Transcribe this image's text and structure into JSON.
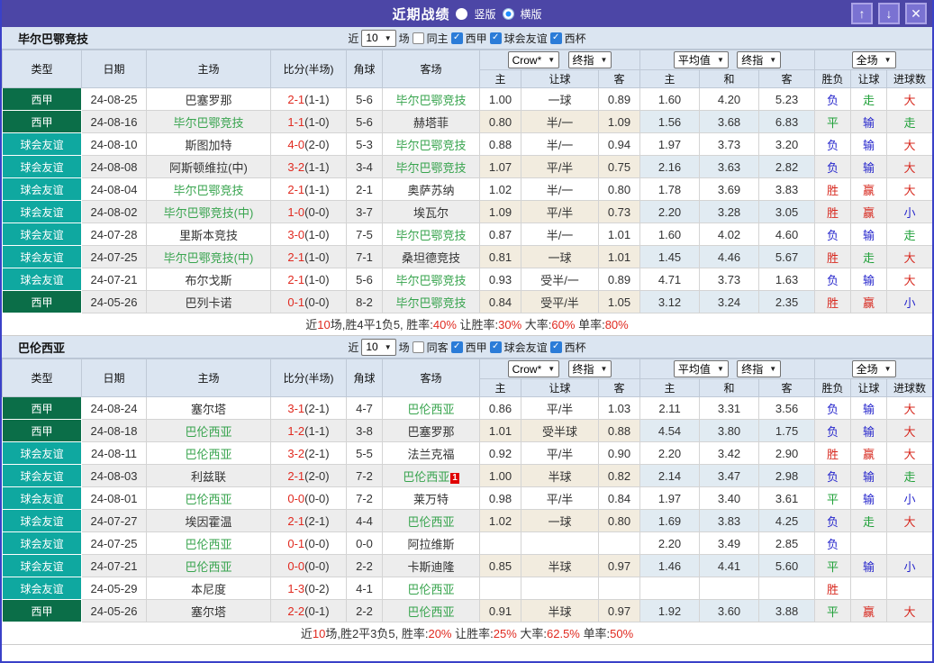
{
  "header": {
    "title": "近期战绩",
    "vertical_label": "竖版",
    "horizontal_label": "横版",
    "vertical_checked": false,
    "horizontal_checked": true
  },
  "icons": {
    "up": "↑",
    "down": "↓",
    "close": "✕",
    "dropdown": "▼"
  },
  "colors": {
    "titlebar": "#4c46a6",
    "team_green": "#38a44e",
    "score_red": "#e02a20",
    "checkbox_blue": "#2b7cd8"
  },
  "type_colors": {
    "西甲": "#0b6e48",
    "球会友谊": "#0fa8a0"
  },
  "result_colors": {
    "胜": "#d7281e",
    "平": "#1fa038",
    "负": "#2626cc",
    "赢": "#d7281e",
    "走": "#1fa038",
    "输": "#2626cc",
    "大": "#d7281e",
    "小": "#2626cc"
  },
  "table_header": {
    "base_cols": [
      "类型",
      "日期",
      "主场",
      "比分(半场)",
      "角球",
      "客场"
    ],
    "odds_source": "Crow*",
    "odds_index": "终指",
    "avg_source": "平均值",
    "avg_index": "终指",
    "scope": "全场",
    "odds_cols": [
      "主",
      "让球",
      "客"
    ],
    "avg_cols": [
      "主",
      "和",
      "客"
    ],
    "result_cols": [
      "胜负",
      "让球",
      "进球数"
    ]
  },
  "sections": [
    {
      "team": "毕尔巴鄂竞技",
      "filters": {
        "near_label": "近",
        "count": "10",
        "games_label": "场",
        "venue_label": "同主",
        "venue_checked": false,
        "leagues": [
          {
            "label": "西甲",
            "checked": true
          },
          {
            "label": "球会友谊",
            "checked": true
          },
          {
            "label": "西杯",
            "checked": true
          }
        ]
      },
      "rows": [
        {
          "type": "西甲",
          "date": "24-08-25",
          "home": "巴塞罗那",
          "home_is_team": false,
          "score": "2-1",
          "half": "(1-1)",
          "corners": "5-6",
          "away": "毕尔巴鄂竞技",
          "away_is_team": true,
          "away_red_cards": "",
          "crow_home": "1.00",
          "crow_handicap": "一球",
          "crow_away": "0.89",
          "avg_home": "1.60",
          "avg_draw": "4.20",
          "avg_away": "5.23",
          "result_wdl": "负",
          "result_handicap": "走",
          "result_goals": "大"
        },
        {
          "type": "西甲",
          "date": "24-08-16",
          "home": "毕尔巴鄂竞技",
          "home_is_team": true,
          "score": "1-1",
          "half": "(1-0)",
          "corners": "5-6",
          "away": "赫塔菲",
          "away_is_team": false,
          "away_red_cards": "",
          "crow_home": "0.80",
          "crow_handicap": "半/一",
          "crow_away": "1.09",
          "avg_home": "1.56",
          "avg_draw": "3.68",
          "avg_away": "6.83",
          "result_wdl": "平",
          "result_handicap": "输",
          "result_goals": "走"
        },
        {
          "type": "球会友谊",
          "date": "24-08-10",
          "home": "斯图加特",
          "home_is_team": false,
          "score": "4-0",
          "half": "(2-0)",
          "corners": "5-3",
          "away": "毕尔巴鄂竞技",
          "away_is_team": true,
          "away_red_cards": "",
          "crow_home": "0.88",
          "crow_handicap": "半/一",
          "crow_away": "0.94",
          "avg_home": "1.97",
          "avg_draw": "3.73",
          "avg_away": "3.20",
          "result_wdl": "负",
          "result_handicap": "输",
          "result_goals": "大"
        },
        {
          "type": "球会友谊",
          "date": "24-08-08",
          "home": "阿斯顿维拉(中)",
          "home_is_team": false,
          "score": "3-2",
          "half": "(1-1)",
          "corners": "3-4",
          "away": "毕尔巴鄂竞技",
          "away_is_team": true,
          "away_red_cards": "",
          "crow_home": "1.07",
          "crow_handicap": "平/半",
          "crow_away": "0.75",
          "avg_home": "2.16",
          "avg_draw": "3.63",
          "avg_away": "2.82",
          "result_wdl": "负",
          "result_handicap": "输",
          "result_goals": "大"
        },
        {
          "type": "球会友谊",
          "date": "24-08-04",
          "home": "毕尔巴鄂竞技",
          "home_is_team": true,
          "score": "2-1",
          "half": "(1-1)",
          "corners": "2-1",
          "away": "奥萨苏纳",
          "away_is_team": false,
          "away_red_cards": "",
          "crow_home": "1.02",
          "crow_handicap": "半/一",
          "crow_away": "0.80",
          "avg_home": "1.78",
          "avg_draw": "3.69",
          "avg_away": "3.83",
          "result_wdl": "胜",
          "result_handicap": "赢",
          "result_goals": "大"
        },
        {
          "type": "球会友谊",
          "date": "24-08-02",
          "home": "毕尔巴鄂竞技(中)",
          "home_is_team": true,
          "score": "1-0",
          "half": "(0-0)",
          "corners": "3-7",
          "away": "埃瓦尔",
          "away_is_team": false,
          "away_red_cards": "",
          "crow_home": "1.09",
          "crow_handicap": "平/半",
          "crow_away": "0.73",
          "avg_home": "2.20",
          "avg_draw": "3.28",
          "avg_away": "3.05",
          "result_wdl": "胜",
          "result_handicap": "赢",
          "result_goals": "小"
        },
        {
          "type": "球会友谊",
          "date": "24-07-28",
          "home": "里斯本竞技",
          "home_is_team": false,
          "score": "3-0",
          "half": "(1-0)",
          "corners": "7-5",
          "away": "毕尔巴鄂竞技",
          "away_is_team": true,
          "away_red_cards": "",
          "crow_home": "0.87",
          "crow_handicap": "半/一",
          "crow_away": "1.01",
          "avg_home": "1.60",
          "avg_draw": "4.02",
          "avg_away": "4.60",
          "result_wdl": "负",
          "result_handicap": "输",
          "result_goals": "走"
        },
        {
          "type": "球会友谊",
          "date": "24-07-25",
          "home": "毕尔巴鄂竞技(中)",
          "home_is_team": true,
          "score": "2-1",
          "half": "(1-0)",
          "corners": "7-1",
          "away": "桑坦德竞技",
          "away_is_team": false,
          "away_red_cards": "",
          "crow_home": "0.81",
          "crow_handicap": "一球",
          "crow_away": "1.01",
          "avg_home": "1.45",
          "avg_draw": "4.46",
          "avg_away": "5.67",
          "result_wdl": "胜",
          "result_handicap": "走",
          "result_goals": "大"
        },
        {
          "type": "球会友谊",
          "date": "24-07-21",
          "home": "布尔戈斯",
          "home_is_team": false,
          "score": "2-1",
          "half": "(1-0)",
          "corners": "5-6",
          "away": "毕尔巴鄂竞技",
          "away_is_team": true,
          "away_red_cards": "",
          "crow_home": "0.93",
          "crow_handicap": "受半/一",
          "crow_away": "0.89",
          "avg_home": "4.71",
          "avg_draw": "3.73",
          "avg_away": "1.63",
          "result_wdl": "负",
          "result_handicap": "输",
          "result_goals": "大"
        },
        {
          "type": "西甲",
          "date": "24-05-26",
          "home": "巴列卡诺",
          "home_is_team": false,
          "score": "0-1",
          "half": "(0-0)",
          "corners": "8-2",
          "away": "毕尔巴鄂竞技",
          "away_is_team": true,
          "away_red_cards": "",
          "crow_home": "0.84",
          "crow_handicap": "受平/半",
          "crow_away": "1.05",
          "avg_home": "3.12",
          "avg_draw": "3.24",
          "avg_away": "2.35",
          "result_wdl": "胜",
          "result_handicap": "赢",
          "result_goals": "小"
        }
      ],
      "summary": [
        {
          "text": "近",
          "red": false
        },
        {
          "text": "10",
          "red": true
        },
        {
          "text": "场,胜4平1负5, 胜率:",
          "red": false
        },
        {
          "text": "40%",
          "red": true
        },
        {
          "text": " 让胜率:",
          "red": false
        },
        {
          "text": "30%",
          "red": true
        },
        {
          "text": " 大率:",
          "red": false
        },
        {
          "text": "60%",
          "red": true
        },
        {
          "text": " 单率:",
          "red": false
        },
        {
          "text": "80%",
          "red": true
        }
      ]
    },
    {
      "team": "巴伦西亚",
      "filters": {
        "near_label": "近",
        "count": "10",
        "games_label": "场",
        "venue_label": "同客",
        "venue_checked": false,
        "leagues": [
          {
            "label": "西甲",
            "checked": true
          },
          {
            "label": "球会友谊",
            "checked": true
          },
          {
            "label": "西杯",
            "checked": true
          }
        ]
      },
      "rows": [
        {
          "type": "西甲",
          "date": "24-08-24",
          "home": "塞尔塔",
          "home_is_team": false,
          "score": "3-1",
          "half": "(2-1)",
          "corners": "4-7",
          "away": "巴伦西亚",
          "away_is_team": true,
          "away_red_cards": "",
          "crow_home": "0.86",
          "crow_handicap": "平/半",
          "crow_away": "1.03",
          "avg_home": "2.11",
          "avg_draw": "3.31",
          "avg_away": "3.56",
          "result_wdl": "负",
          "result_handicap": "输",
          "result_goals": "大"
        },
        {
          "type": "西甲",
          "date": "24-08-18",
          "home": "巴伦西亚",
          "home_is_team": true,
          "score": "1-2",
          "half": "(1-1)",
          "corners": "3-8",
          "away": "巴塞罗那",
          "away_is_team": false,
          "away_red_cards": "",
          "crow_home": "1.01",
          "crow_handicap": "受半球",
          "crow_away": "0.88",
          "avg_home": "4.54",
          "avg_draw": "3.80",
          "avg_away": "1.75",
          "result_wdl": "负",
          "result_handicap": "输",
          "result_goals": "大"
        },
        {
          "type": "球会友谊",
          "date": "24-08-11",
          "home": "巴伦西亚",
          "home_is_team": true,
          "score": "3-2",
          "half": "(2-1)",
          "corners": "5-5",
          "away": "法兰克福",
          "away_is_team": false,
          "away_red_cards": "",
          "crow_home": "0.92",
          "crow_handicap": "平/半",
          "crow_away": "0.90",
          "avg_home": "2.20",
          "avg_draw": "3.42",
          "avg_away": "2.90",
          "result_wdl": "胜",
          "result_handicap": "赢",
          "result_goals": "大"
        },
        {
          "type": "球会友谊",
          "date": "24-08-03",
          "home": "利兹联",
          "home_is_team": false,
          "score": "2-1",
          "half": "(2-0)",
          "corners": "7-2",
          "away": "巴伦西亚",
          "away_is_team": true,
          "away_red_cards": "1",
          "crow_home": "1.00",
          "crow_handicap": "半球",
          "crow_away": "0.82",
          "avg_home": "2.14",
          "avg_draw": "3.47",
          "avg_away": "2.98",
          "result_wdl": "负",
          "result_handicap": "输",
          "result_goals": "走"
        },
        {
          "type": "球会友谊",
          "date": "24-08-01",
          "home": "巴伦西亚",
          "home_is_team": true,
          "score": "0-0",
          "half": "(0-0)",
          "corners": "7-2",
          "away": "莱万特",
          "away_is_team": false,
          "away_red_cards": "",
          "crow_home": "0.98",
          "crow_handicap": "平/半",
          "crow_away": "0.84",
          "avg_home": "1.97",
          "avg_draw": "3.40",
          "avg_away": "3.61",
          "result_wdl": "平",
          "result_handicap": "输",
          "result_goals": "小"
        },
        {
          "type": "球会友谊",
          "date": "24-07-27",
          "home": "埃因霍温",
          "home_is_team": false,
          "score": "2-1",
          "half": "(2-1)",
          "corners": "4-4",
          "away": "巴伦西亚",
          "away_is_team": true,
          "away_red_cards": "",
          "crow_home": "1.02",
          "crow_handicap": "一球",
          "crow_away": "0.80",
          "avg_home": "1.69",
          "avg_draw": "3.83",
          "avg_away": "4.25",
          "result_wdl": "负",
          "result_handicap": "走",
          "result_goals": "大"
        },
        {
          "type": "球会友谊",
          "date": "24-07-25",
          "home": "巴伦西亚",
          "home_is_team": true,
          "score": "0-1",
          "half": "(0-0)",
          "corners": "0-0",
          "away": "阿拉维斯",
          "away_is_team": false,
          "away_red_cards": "",
          "crow_home": "",
          "crow_handicap": "",
          "crow_away": "",
          "avg_home": "2.20",
          "avg_draw": "3.49",
          "avg_away": "2.85",
          "result_wdl": "负",
          "result_handicap": "",
          "result_goals": ""
        },
        {
          "type": "球会友谊",
          "date": "24-07-21",
          "home": "巴伦西亚",
          "home_is_team": true,
          "score": "0-0",
          "half": "(0-0)",
          "corners": "2-2",
          "away": "卡斯迪隆",
          "away_is_team": false,
          "away_red_cards": "",
          "crow_home": "0.85",
          "crow_handicap": "半球",
          "crow_away": "0.97",
          "avg_home": "1.46",
          "avg_draw": "4.41",
          "avg_away": "5.60",
          "result_wdl": "平",
          "result_handicap": "输",
          "result_goals": "小"
        },
        {
          "type": "球会友谊",
          "date": "24-05-29",
          "home": "本尼度",
          "home_is_team": false,
          "score": "1-3",
          "half": "(0-2)",
          "corners": "4-1",
          "away": "巴伦西亚",
          "away_is_team": true,
          "away_red_cards": "",
          "crow_home": "",
          "crow_handicap": "",
          "crow_away": "",
          "avg_home": "",
          "avg_draw": "",
          "avg_away": "",
          "result_wdl": "胜",
          "result_handicap": "",
          "result_goals": ""
        },
        {
          "type": "西甲",
          "date": "24-05-26",
          "home": "塞尔塔",
          "home_is_team": false,
          "score": "2-2",
          "half": "(0-1)",
          "corners": "2-2",
          "away": "巴伦西亚",
          "away_is_team": true,
          "away_red_cards": "",
          "crow_home": "0.91",
          "crow_handicap": "半球",
          "crow_away": "0.97",
          "avg_home": "1.92",
          "avg_draw": "3.60",
          "avg_away": "3.88",
          "result_wdl": "平",
          "result_handicap": "赢",
          "result_goals": "大"
        }
      ],
      "summary": [
        {
          "text": "近",
          "red": false
        },
        {
          "text": "10",
          "red": true
        },
        {
          "text": "场,胜2平3负5, 胜率:",
          "red": false
        },
        {
          "text": "20%",
          "red": true
        },
        {
          "text": " 让胜率:",
          "red": false
        },
        {
          "text": "25%",
          "red": true
        },
        {
          "text": " 大率:",
          "red": false
        },
        {
          "text": "62.5%",
          "red": true
        },
        {
          "text": " 单率:",
          "red": false
        },
        {
          "text": "50%",
          "red": true
        }
      ]
    }
  ]
}
